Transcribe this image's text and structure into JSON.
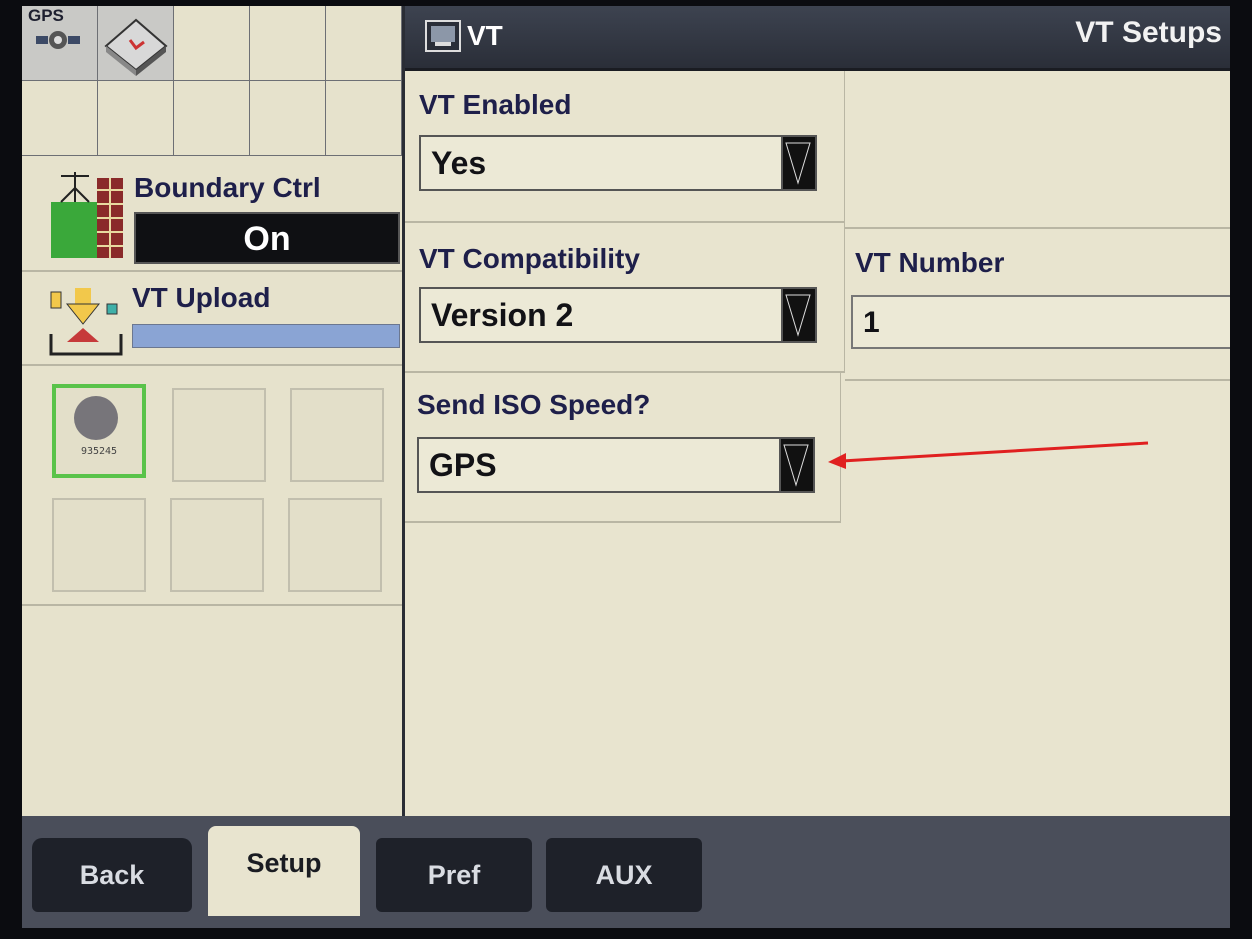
{
  "left_panel": {
    "gps_label": "GPS",
    "boundary": {
      "title": "Boundary Ctrl",
      "state": "On"
    },
    "upload": {
      "title": "VT Upload",
      "progress_fraction": 1.0
    },
    "slots": [
      {
        "label": "935245",
        "active": true
      },
      {
        "label": "",
        "active": false
      },
      {
        "label": "",
        "active": false
      },
      {
        "label": "",
        "active": false
      },
      {
        "label": "",
        "active": false
      },
      {
        "label": "",
        "active": false
      }
    ]
  },
  "header": {
    "app_title": "VT",
    "page_title": "VT Setups"
  },
  "fields": {
    "vt_enabled": {
      "label": "VT Enabled",
      "value": "Yes"
    },
    "vt_compatibility": {
      "label": "VT Compatibility",
      "value": "Version 2"
    },
    "vt_number": {
      "label": "VT Number",
      "value": "1"
    },
    "send_iso_speed": {
      "label": "Send ISO Speed?",
      "value": "GPS"
    }
  },
  "tabs": {
    "back": "Back",
    "setup": "Setup",
    "pref": "Pref",
    "aux": "AUX"
  },
  "colors": {
    "screen_bg": "#e8e4cf",
    "header_bg": "#2f333d",
    "label_text": "#1e1f4a",
    "active_slot": "#5ac34a",
    "annotation_arrow": "#e02020"
  }
}
